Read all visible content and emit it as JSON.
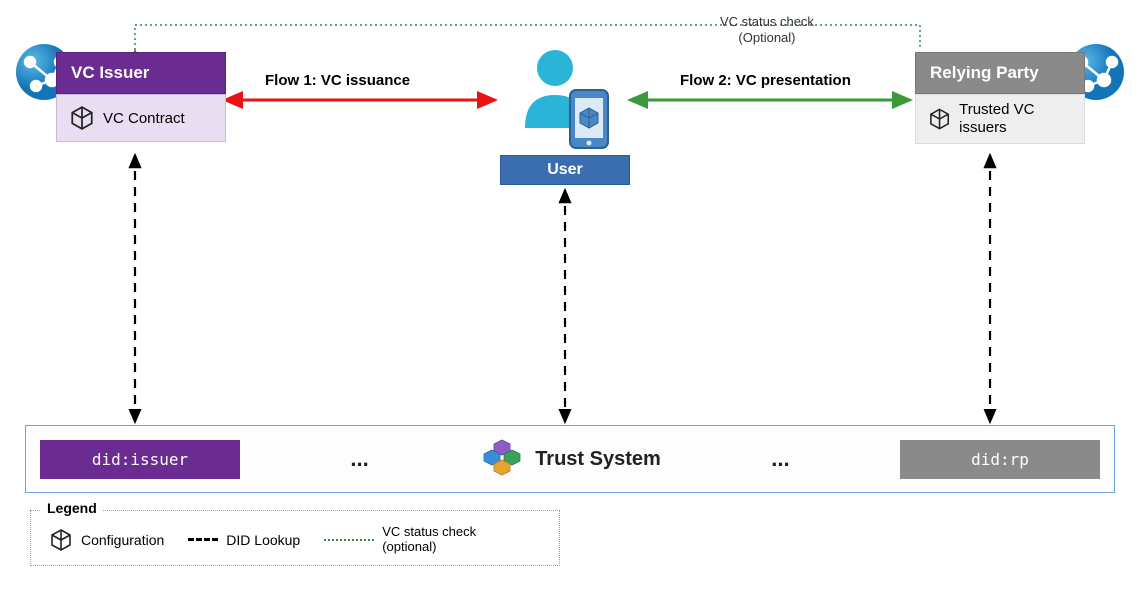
{
  "issuer": {
    "title": "VC Issuer",
    "contract": "VC Contract"
  },
  "user": {
    "label": "User"
  },
  "rp": {
    "title": "Relying Party",
    "trusted": "Trusted VC issuers"
  },
  "flows": {
    "flow1": "Flow 1: VC  issuance",
    "flow2": "Flow 2: VC presentation"
  },
  "status_check": {
    "line1": "VC status check",
    "line2": "(Optional)"
  },
  "trust": {
    "did_issuer": "did:issuer",
    "did_rp": "did:rp",
    "label": "Trust System",
    "ellipsis": "..."
  },
  "legend": {
    "title": "Legend",
    "config": "Configuration",
    "did_lookup": "DID Lookup",
    "status_line1": "VC status check",
    "status_line2": "(optional)"
  }
}
